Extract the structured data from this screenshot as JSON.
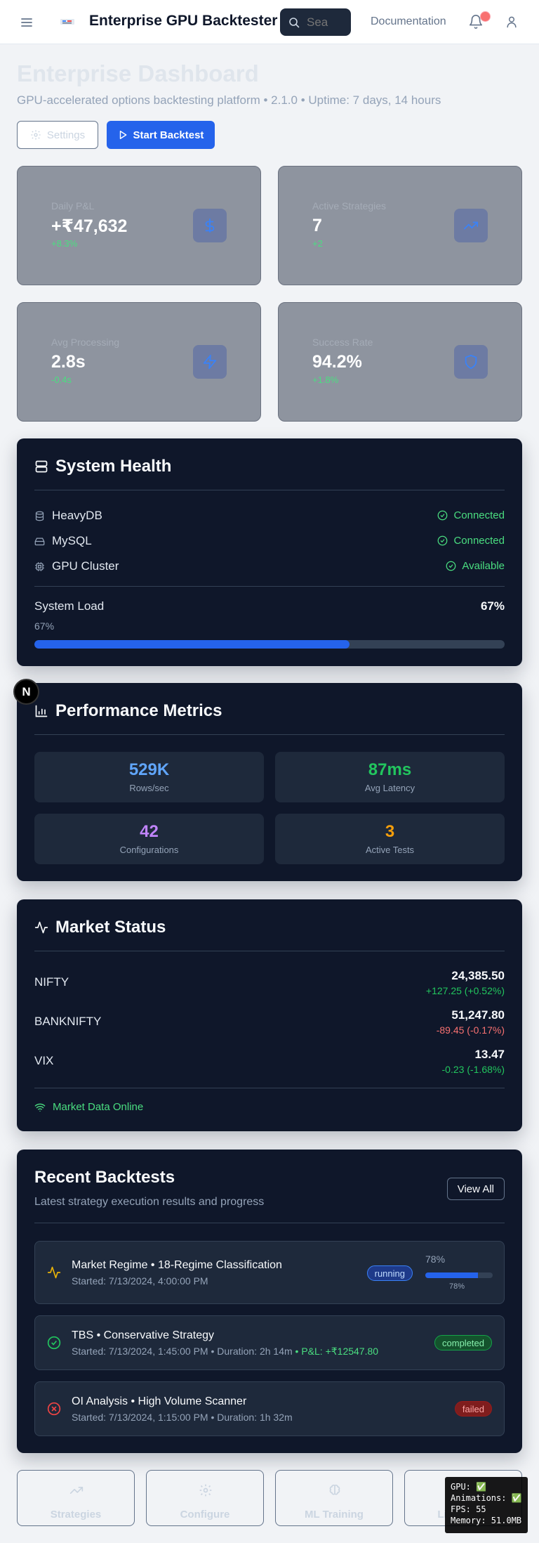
{
  "header": {
    "app_title": "Enterprise GPU Backtester",
    "search_placeholder": "Sea",
    "documentation_label": "Documentation"
  },
  "dashboard": {
    "title": "Enterprise Dashboard",
    "subtitle": "GPU-accelerated options backtesting platform • 2.1.0 • Uptime: 7 days, 14 hours",
    "settings_label": "Settings",
    "start_label": "Start Backtest"
  },
  "stats": [
    {
      "label": "Daily P&L",
      "value": "+₹47,632",
      "change": "+8.3%",
      "icon": "dollar-icon"
    },
    {
      "label": "Active Strategies",
      "value": "7",
      "change": "+2",
      "icon": "trending-up-icon"
    },
    {
      "label": "Avg Processing",
      "value": "2.8s",
      "change": "-0.4s",
      "icon": "zap-icon"
    },
    {
      "label": "Success Rate",
      "value": "94.2%",
      "change": "+1.8%",
      "icon": "shield-icon"
    }
  ],
  "system_health": {
    "title": "System Health",
    "items": [
      {
        "name": "HeavyDB",
        "status": "Connected"
      },
      {
        "name": "MySQL",
        "status": "Connected"
      },
      {
        "name": "GPU Cluster",
        "status": "Available"
      }
    ],
    "load_label": "System Load",
    "load_value": "67%",
    "load_small": "67%",
    "load_fraction": 0.67
  },
  "performance": {
    "title": "Performance Metrics",
    "metrics": [
      {
        "value": "529K",
        "label": "Rows/sec",
        "color": "#60a5fa"
      },
      {
        "value": "87ms",
        "label": "Avg Latency",
        "color": "#22c55e"
      },
      {
        "value": "42",
        "label": "Configurations",
        "color": "#c084fc"
      },
      {
        "value": "3",
        "label": "Active Tests",
        "color": "#f59e0b"
      }
    ]
  },
  "market": {
    "title": "Market Status",
    "rows": [
      {
        "name": "NIFTY",
        "price": "24,385.50",
        "change": "+127.25 (+0.52%)",
        "direction": "up"
      },
      {
        "name": "BANKNIFTY",
        "price": "51,247.80",
        "change": "-89.45 (-0.17%)",
        "direction": "down"
      },
      {
        "name": "VIX",
        "price": "13.47",
        "change": "-0.23 (-1.68%)",
        "direction": "up"
      }
    ],
    "status": "Market Data Online"
  },
  "backtests": {
    "title": "Recent Backtests",
    "subtitle": "Latest strategy execution results and progress",
    "view_all": "View All",
    "items": [
      {
        "title": "Market Regime • 18-Regime Classification",
        "meta": "Started: 7/13/2024, 4:00:00 PM",
        "status": "running",
        "progress_label": "78%",
        "progress_small": "78%",
        "progress": 0.78
      },
      {
        "title": "TBS • Conservative Strategy",
        "meta": "Started: 7/13/2024, 1:45:00 PM • Duration: 2h 14m",
        "pnl": "• P&L: +₹12547.80",
        "status": "completed"
      },
      {
        "title": "OI Analysis • High Volume Scanner",
        "meta": "Started: 7/13/2024, 1:15:00 PM • Duration: 1h 32m",
        "status": "failed"
      }
    ]
  },
  "quick_links": [
    "Strategies",
    "Configure",
    "ML Training",
    "Li"
  ],
  "next_badge": "N",
  "debug": [
    "GPU: ✅",
    "Animations: ✅",
    "FPS: 55",
    "Memory: 51.0MB"
  ]
}
